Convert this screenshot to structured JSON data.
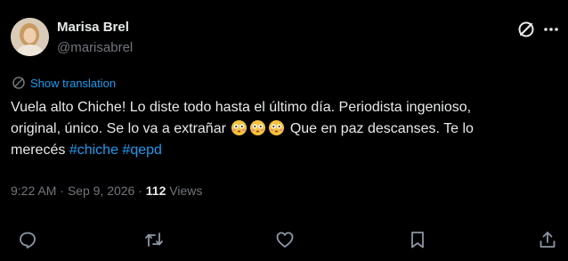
{
  "author": {
    "display_name": "Marisa Brel",
    "handle": "@marisabrel"
  },
  "translation": {
    "label": "Show translation"
  },
  "tweet": {
    "line1": "Vuela alto Chiche! Lo diste todo hasta el último día. Periodista ingenioso,",
    "line2a": "original, único. Se lo va a extrañar",
    "line2b": "Que en paz descanses. Te lo",
    "line3a": "merecés",
    "hashtag1": "#chiche",
    "hashtag2": "#qepd",
    "emojis": [
      "flushed-face",
      "flushed-face",
      "flushed-face"
    ]
  },
  "meta": {
    "time": "9:22 AM",
    "separator1": "·",
    "date": "Sep 9, 2026",
    "separator2": "·",
    "views_count": "112",
    "views_label": "Views"
  },
  "icons": {
    "grok": "grok-icon",
    "more": "more-icon",
    "reply": "reply-icon",
    "retweet": "retweet-icon",
    "like": "heart-icon",
    "bookmark": "bookmark-icon",
    "share": "share-icon"
  },
  "colors": {
    "background": "#000000",
    "text": "#e7e9ea",
    "muted": "#71767b",
    "accent": "#1d9bf0"
  }
}
